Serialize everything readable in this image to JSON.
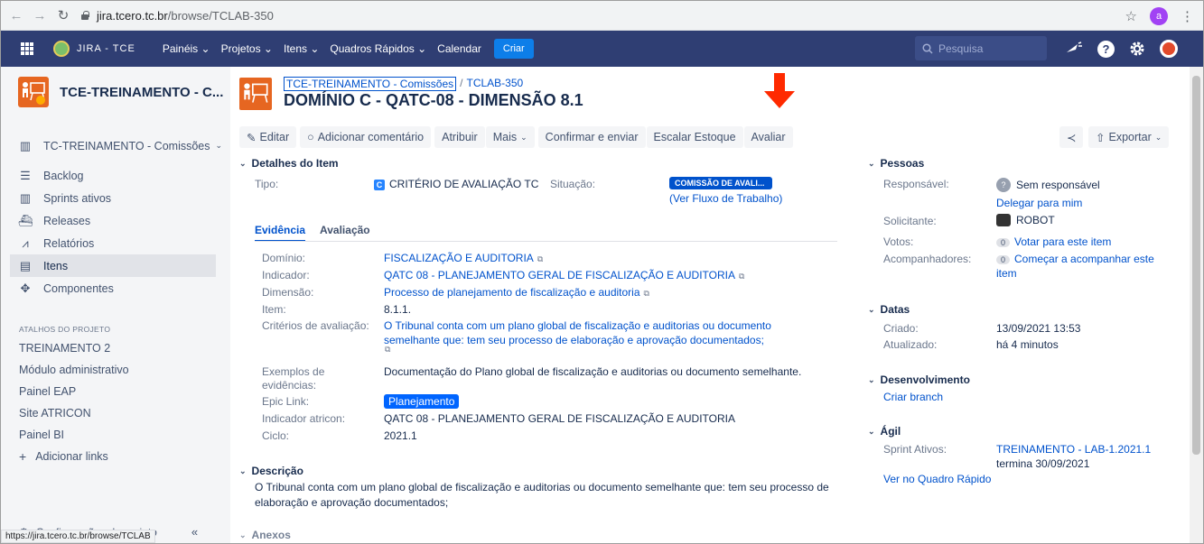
{
  "browser": {
    "url_host": "jira.tcero.tc.br",
    "url_path": "/browse/TCLAB-350",
    "profile_letter": "a"
  },
  "jira": {
    "brand": "JIRA - TCE",
    "menu": [
      "Painéis ⌄",
      "Projetos ⌄",
      "Itens ⌄",
      "Quadros Rápidos ⌄",
      "Calendar"
    ],
    "create_label": "Criar",
    "search_placeholder": "Pesquisa"
  },
  "sidebar": {
    "project_name": "TCE-TREINAMENTO - C...",
    "board_selector": "TC-TREINAMENTO - Comissões",
    "items": [
      {
        "label": "Backlog",
        "icon": "backlog-icon"
      },
      {
        "label": "Sprints ativos",
        "icon": "board-icon"
      },
      {
        "label": "Releases",
        "icon": "ship-icon"
      },
      {
        "label": "Relatórios",
        "icon": "chart-icon"
      },
      {
        "label": "Itens",
        "icon": "issues-icon"
      },
      {
        "label": "Componentes",
        "icon": "puzzle-icon"
      }
    ],
    "shortcuts_heading": "ATALHOS DO PROJETO",
    "shortcuts": [
      "TREINAMENTO 2",
      "Módulo administrativo",
      "Painel EAP",
      "Site ATRICON",
      "Painel BI"
    ],
    "add_links": "Adicionar links",
    "settings": "Configurações do projeto",
    "status_url": "https://jira.tcero.tc.br/browse/TCLAB"
  },
  "issue": {
    "breadcrumb_project": "TCE-TREINAMENTO - Comissões",
    "breadcrumb_key": "TCLAB-350",
    "title": "DOMÍNIO C - QATC-08 - DIMENSÃO 8.1",
    "toolbar": {
      "edit": "Editar",
      "comment": "Adicionar comentário",
      "assign": "Atribuir",
      "more": "Mais",
      "confirm": "Confirmar e enviar",
      "escalate": "Escalar Estoque",
      "evaluate": "Avaliar",
      "export": "Exportar"
    },
    "details_heading": "Detalhes do Item",
    "type_label": "Tipo:",
    "type_value": "CRITÉRIO DE AVALIAÇÃO TC",
    "status_label": "Situação:",
    "status_value": "COMISSÃO DE AVALI...",
    "workflow_link": "(Ver Fluxo de Trabalho)",
    "tabs": [
      "Evidência",
      "Avaliação"
    ],
    "fields": {
      "dominio_label": "Domínio:",
      "dominio_value": "FISCALIZAÇÃO E AUDITORIA",
      "indicador_label": "Indicador:",
      "indicador_value": "QATC 08 - PLANEJAMENTO GERAL DE FISCALIZAÇÃO E AUDITORIA",
      "dimensao_label": "Dimensão:",
      "dimensao_value": "Processo de planejamento de fiscalização e auditoria",
      "item_label": "Item:",
      "item_value": "8.1.1.",
      "criterios_label": "Critérios de avaliação:",
      "criterios_line1": "O Tribunal conta com um plano global de fiscalização e auditorias ou documento",
      "criterios_line2": "semelhante que: tem seu processo de elaboração e aprovação documentados;",
      "exemplos_label1": "Exemplos de",
      "exemplos_label2": "evidências:",
      "exemplos_value": "Documentação do Plano global de fiscalização e auditorias ou documento semelhante.",
      "epic_label": "Epic Link:",
      "epic_value": "Planejamento",
      "atricon_label": "Indicador atricon:",
      "atricon_value": "QATC 08 - PLANEJAMENTO GERAL DE FISCALIZAÇÃO E AUDITORIA",
      "ciclo_label": "Ciclo:",
      "ciclo_value": "2021.1"
    },
    "description_heading": "Descrição",
    "description_line1": "O Tribunal conta com um plano global de fiscalização e auditorias ou documento semelhante que: tem seu processo de",
    "description_line2": "elaboração e aprovação documentados;",
    "attachments_heading": "Anexos"
  },
  "people": {
    "heading": "Pessoas",
    "assignee_label": "Responsável:",
    "assignee_value": "Sem responsável",
    "assign_me": "Delegar para mim",
    "reporter_label": "Solicitante:",
    "reporter_value": "ROBOT",
    "votes_label": "Votos:",
    "votes_count": "0",
    "votes_link": "Votar para este item",
    "watchers_label": "Acompanhadores:",
    "watchers_count": "0",
    "watch_line1": "Começar a acompanhar este",
    "watch_line2": "item"
  },
  "dates": {
    "heading": "Datas",
    "created_label": "Criado:",
    "created_value": "13/09/2021 13:53",
    "updated_label": "Atualizado:",
    "updated_value": "há 4 minutos"
  },
  "development": {
    "heading": "Desenvolvimento",
    "create_branch": "Criar branch"
  },
  "agile": {
    "heading": "Ágil",
    "sprint_label": "Sprint Ativos:",
    "sprint_value": "TREINAMENTO - LAB-1.2021.1",
    "sprint_end": "termina 30/09/2021",
    "board_link": "Ver no Quadro Rápido"
  },
  "colors": {
    "jira_header": "#2f3e73",
    "link": "#0052cc",
    "arrow": "#ff2a00",
    "project": "#e66621"
  }
}
